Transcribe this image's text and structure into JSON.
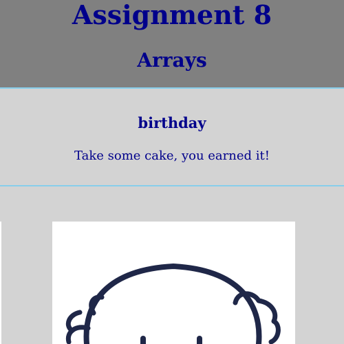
{
  "header": {
    "title": "Assignment 8",
    "subtitle": "Arrays",
    "background_color": "#808080"
  },
  "section": {
    "heading": "birthday",
    "text": "Take some cake, you earned it!"
  },
  "image": {
    "icon": "cartoon-face-icon",
    "description_visible": false
  },
  "colors": {
    "text": "#00008b",
    "page_background": "#d3d3d3",
    "divider": "#87ceeb",
    "illustration_stroke": "#1f2748"
  }
}
